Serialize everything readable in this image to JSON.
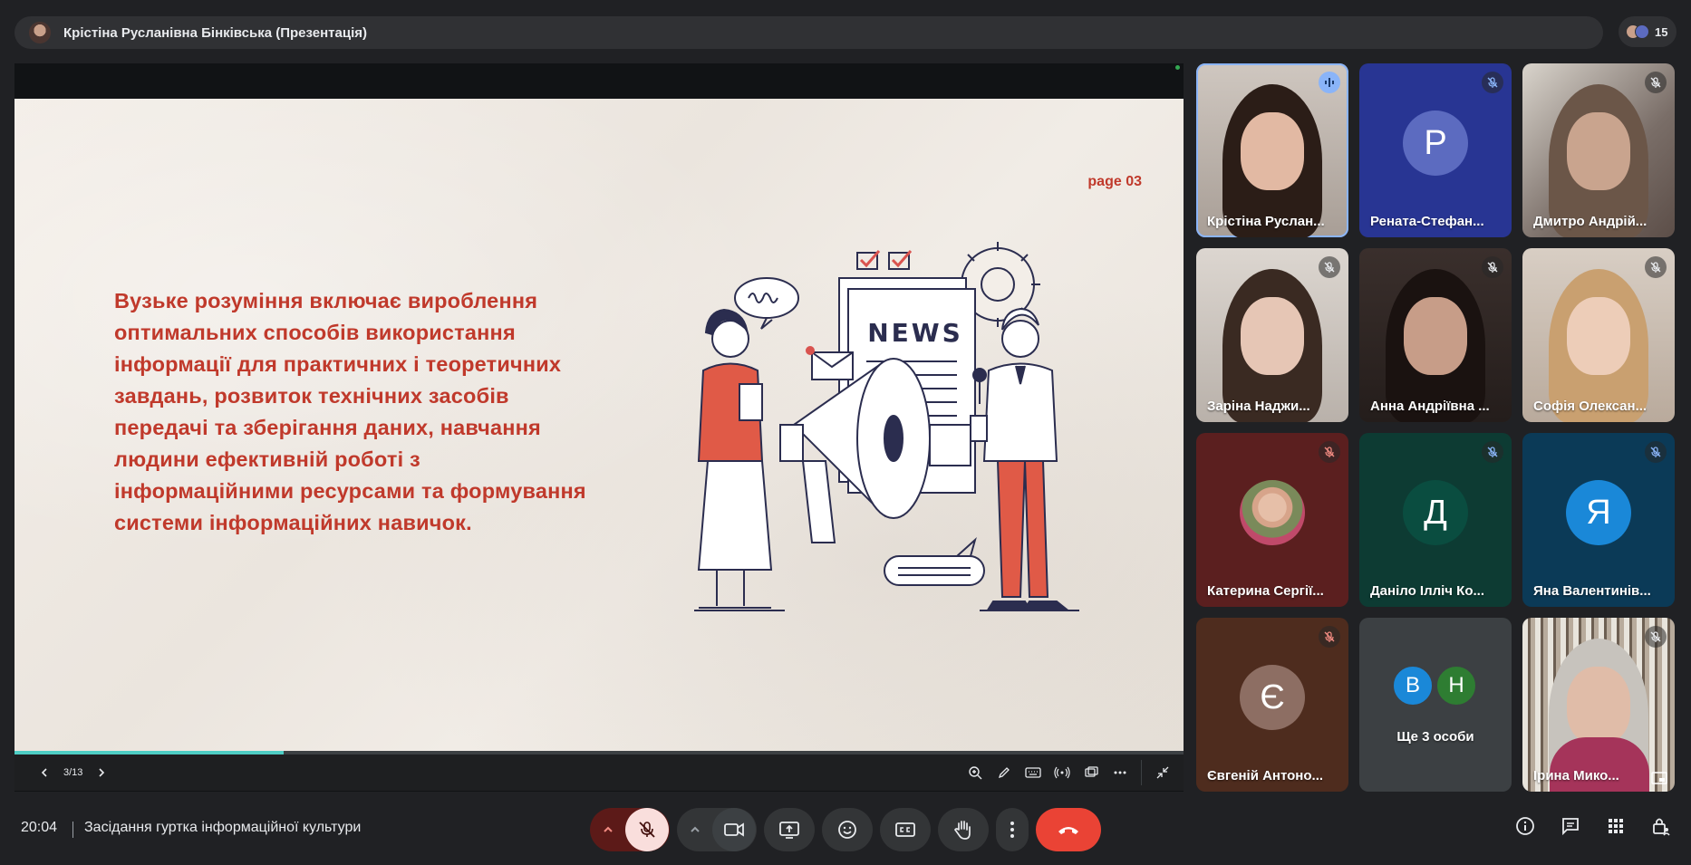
{
  "presenter": {
    "label": "Крістіна Русланівна Бінківська (Презентація)"
  },
  "people": {
    "count": "15"
  },
  "slide": {
    "page_label": "page 03",
    "body_text": "Вузьке розуміння включає вироблення оптимальних способів використання інформації для практичних і теоретичних завдань, розвиток технічних засобів передачі та зберігання даних, навчання людини ефективній роботі з інформаційними ресурсами та формування системи інформаційних навичок.",
    "illustration_text": "NEWS",
    "progress_fraction": 0.23
  },
  "slide_controls": {
    "page": "3/13"
  },
  "participants": [
    {
      "name": "Крістіна Руслан...",
      "type": "video",
      "status": "speaking"
    },
    {
      "name": "Рената-Стефан...",
      "type": "letter",
      "letter": "Р",
      "bg": "#283593",
      "avatar": "#5c6bc0",
      "status": "muted"
    },
    {
      "name": "Дмитро Андрій...",
      "type": "video",
      "status": "muted"
    },
    {
      "name": "Заріна Наджи...",
      "type": "video",
      "status": "muted"
    },
    {
      "name": "Анна Андріївна ...",
      "type": "video",
      "status": "muted"
    },
    {
      "name": "Софія Олексан...",
      "type": "video",
      "status": "muted"
    },
    {
      "name": "Катерина Сергії...",
      "type": "photo",
      "bg": "#5b1f1f",
      "status": "muted"
    },
    {
      "name": "Даніло Ілліч Ко...",
      "type": "letter",
      "letter": "Д",
      "bg": "#0d3b33",
      "avatar": "#0a4d40",
      "status": "muted"
    },
    {
      "name": "Яна Валентинів...",
      "type": "letter",
      "letter": "Я",
      "bg": "#0b3a57",
      "avatar": "#1a88d8",
      "status": "muted"
    },
    {
      "name": "Євгеній Антоно...",
      "type": "letter",
      "letter": "Є",
      "bg": "#4e2c1e",
      "avatar": "#8d6e63",
      "status": "muted"
    },
    {
      "name": "Ще 3 особи",
      "type": "more",
      "letters": [
        "В",
        "Н"
      ]
    },
    {
      "name": "Ірина Мико...",
      "type": "video",
      "status": "muted"
    }
  ],
  "meeting": {
    "time": "20:04",
    "title": "Засідання гуртка інформаційної культури"
  },
  "colors": {
    "accent_red": "#c0392b",
    "end_call": "#ea4335",
    "mic_off_bg": "#f9dedc",
    "speaking": "#8ab4f8"
  }
}
